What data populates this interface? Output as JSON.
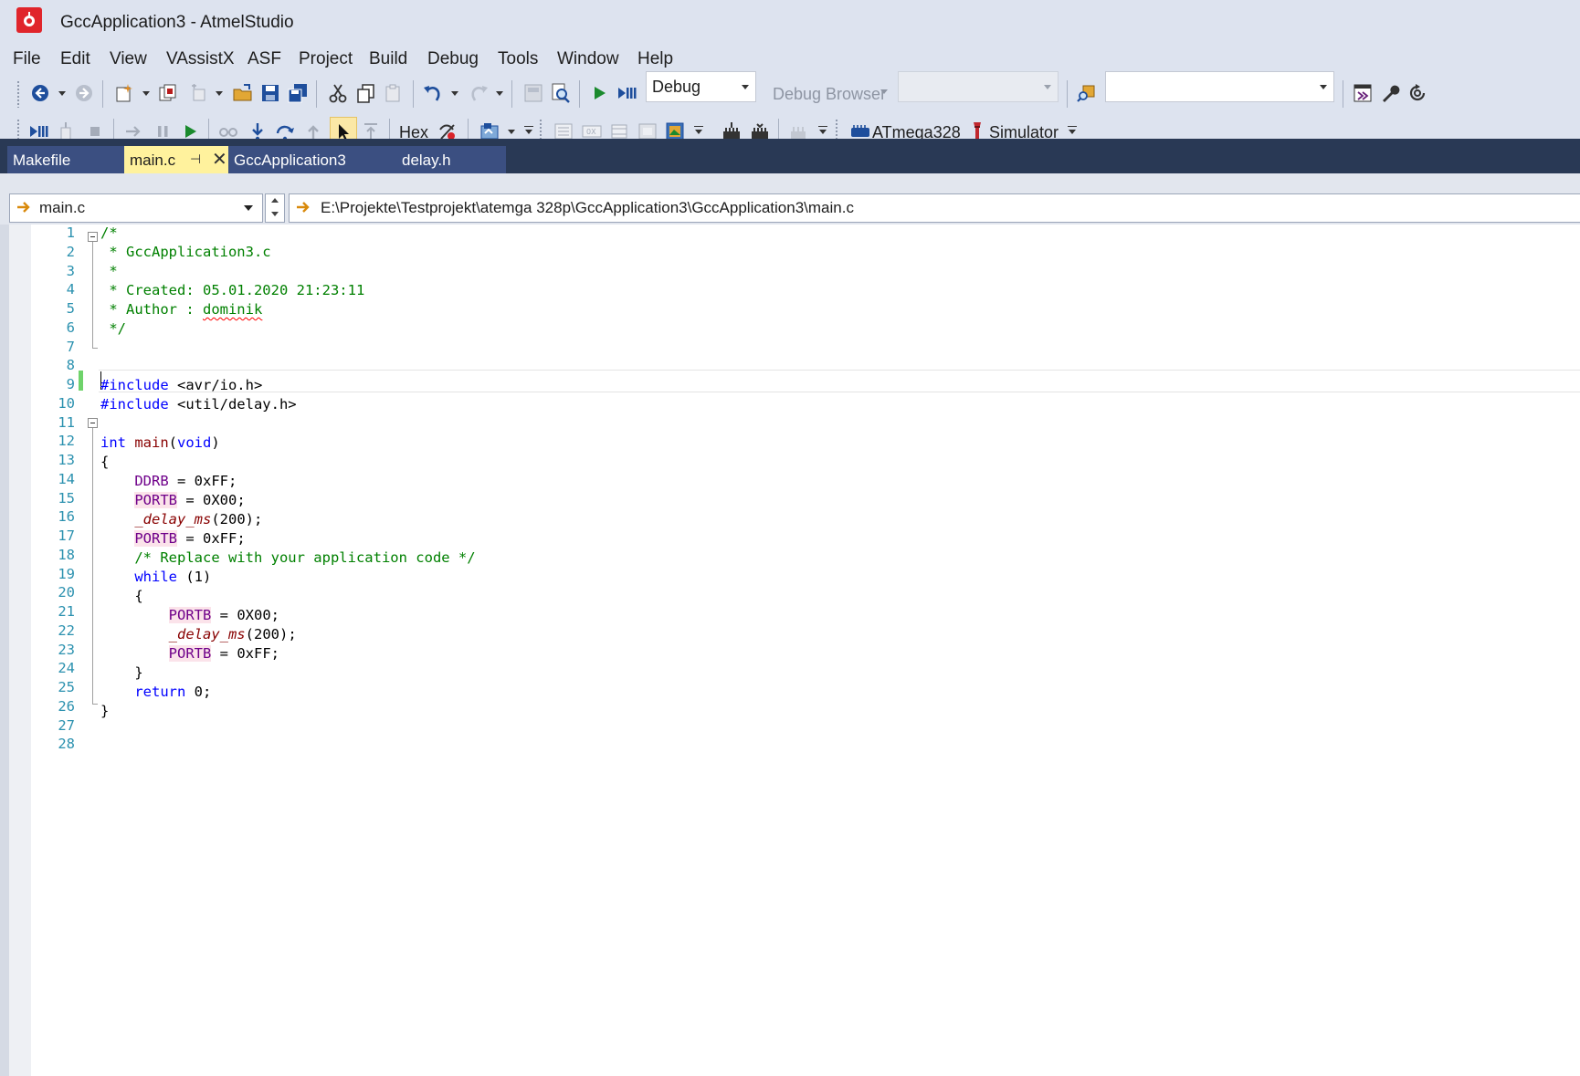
{
  "window": {
    "title": "GccApplication3 - AtmelStudio"
  },
  "menu": [
    "File",
    "Edit",
    "View",
    "VAssistX",
    "ASF",
    "Project",
    "Build",
    "Debug",
    "Tools",
    "Window",
    "Help"
  ],
  "toolbar1": {
    "config_value": "Debug",
    "debug_browser_label": "Debug Browser",
    "platform_value": "",
    "find_value": ""
  },
  "toolbar2": {
    "hex_label": "Hex",
    "device_label": "ATmega328",
    "tool_label": "Simulator"
  },
  "tabs": [
    {
      "label": "Makefile",
      "active": false
    },
    {
      "label": "main.c",
      "active": true
    },
    {
      "label": "GccApplication3",
      "active": false
    },
    {
      "label": "delay.h",
      "active": false
    }
  ],
  "navbar": {
    "file": "main.c",
    "path": "E:\\Projekte\\Testprojekt\\atemga 328p\\GccApplication3\\GccApplication3\\main.c"
  },
  "editor": {
    "line_numbers": [
      "1",
      "2",
      "3",
      "4",
      "5",
      "6",
      "7",
      "8",
      "9",
      "10",
      "11",
      "12",
      "13",
      "14",
      "15",
      "16",
      "17",
      "18",
      "19",
      "20",
      "21",
      "22",
      "23",
      "24",
      "25",
      "26",
      "27",
      "28"
    ],
    "code": {
      "l1": "/*",
      "l2": " * GccApplication3.c",
      "l3": " *",
      "l4": " * Created: 05.01.2020 21:23:11",
      "l5_prefix": " * Author : ",
      "l5_author": "dominik",
      "l6": " */",
      "l9_kw": "#include",
      "l9_rest": " <avr/io.h>",
      "l10_kw": "#include",
      "l10_rest": " <util/delay.h>",
      "l12_kw": "int",
      "l12_name": "main",
      "l12_open": "(",
      "l12_void": "void",
      "l12_close": ")",
      "l13": "{",
      "l14_reg": "DDRB",
      "l14_rest": " = 0xFF;",
      "l15_reg": "PORTB",
      "l15_rest": " = 0X00;",
      "l16_fn": "_delay_ms",
      "l16_rest": "(200);",
      "l17_reg": "PORTB",
      "l17_rest": " = 0xFF;",
      "l18": "/* Replace with your application code */",
      "l19_kw": "while",
      "l19_rest": " (1)",
      "l20": "{",
      "l21_reg": "PORTB",
      "l21_rest": " = 0X00;",
      "l22_fn": "_delay_ms",
      "l22_rest": "(200);",
      "l23_reg": "PORTB",
      "l23_rest": " = 0xFF;",
      "l24": "}",
      "l25_kw": "return",
      "l25_rest": " 0;",
      "l26": "}"
    }
  },
  "colors": {
    "title_bg": "#dde3ef",
    "tab_strip": "#293955",
    "active_tab": "#fff29d",
    "comment": "#008000",
    "keyword": "#0000ff",
    "macro": "#6f008a",
    "line_number": "#2b91af"
  }
}
